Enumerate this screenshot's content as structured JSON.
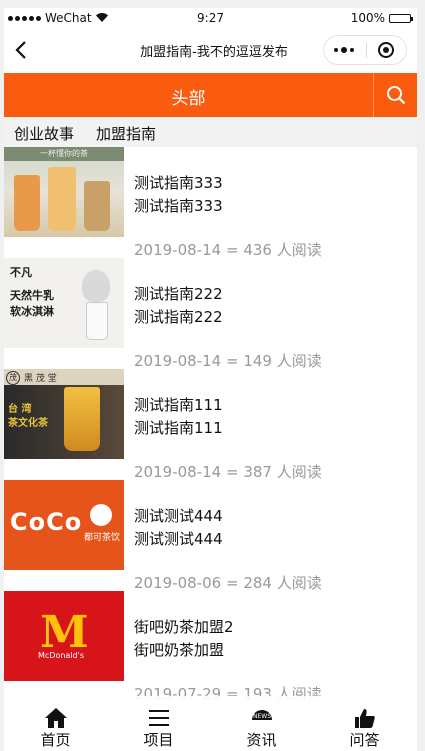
{
  "status_bar": {
    "carrier": "WeChat",
    "time": "9:27",
    "battery": "100%"
  },
  "nav": {
    "title": "加盟指南-我不的逗逗发布"
  },
  "header": {
    "title": "头部",
    "color": "#f95c0f"
  },
  "tabs": [
    {
      "label": "创业故事"
    },
    {
      "label": "加盟指南"
    }
  ],
  "articles": [
    {
      "line1": "测试指南333",
      "line2": "测试指南333",
      "date": "2019-08-14",
      "views": "436",
      "thumb_text": "一杯懂你的茶"
    },
    {
      "line1": "测试指南222",
      "line2": "测试指南222",
      "date": "2019-08-14",
      "views": "149",
      "thumb_text": "天然牛乳\n软冰淇淋",
      "thumb_brand": "不凡"
    },
    {
      "line1": "测试指南111",
      "line2": "测试指南111",
      "date": "2019-08-14",
      "views": "387",
      "thumb_text": "台 湾\n茶文化茶",
      "thumb_brand": "黑 茂 堂"
    },
    {
      "line1": "测试测试444",
      "line2": "测试测试444",
      "date": "2019-08-06",
      "views": "284",
      "thumb_text": "CoCo",
      "thumb_brand": "都可茶饮"
    },
    {
      "line1": "街吧奶茶加盟2",
      "line2": "街吧奶茶加盟",
      "date": "2019-07-29",
      "views": "193",
      "thumb_text": "M",
      "thumb_brand": "McDonald's"
    }
  ],
  "meta_sep": "=",
  "meta_suffix": "人阅读",
  "tabbar": [
    {
      "label": "首页",
      "icon": "home-icon"
    },
    {
      "label": "项目",
      "icon": "menu-icon"
    },
    {
      "label": "资讯",
      "icon": "news-icon",
      "icon_text": "NEWS"
    },
    {
      "label": "问答",
      "icon": "thumbs-up-icon"
    }
  ]
}
